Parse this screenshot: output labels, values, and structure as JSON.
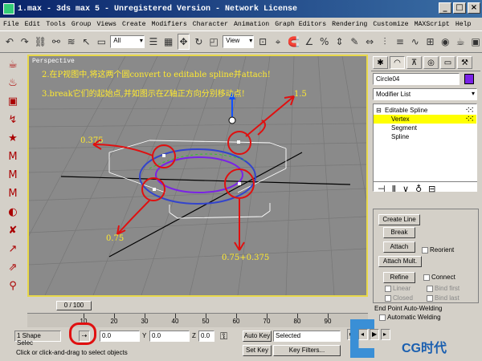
{
  "window": {
    "title": "1.max - 3ds max 5 - Unregistered Version - Network License"
  },
  "menu": [
    "File",
    "Edit",
    "Tools",
    "Group",
    "Views",
    "Create",
    "Modifiers",
    "Character",
    "Animation",
    "Graph Editors",
    "Rendering",
    "Customize",
    "MAXScript",
    "Help"
  ],
  "toolbar": {
    "selection_filter": "All",
    "ref_coord": "View"
  },
  "viewport": {
    "label": "Perspective",
    "note_line1": "2.在P视图中,将这两个圆convert to editable spline并attach!",
    "note_line2": "3.break它们的起始点,并如图示在Z轴正方向分别移动点!",
    "labels": {
      "a": "1.5",
      "b": "0.375",
      "c": "0.75",
      "d": "0.75+0.375"
    }
  },
  "command_panel": {
    "object_name": "Circle04",
    "object_color": "#7a22e6",
    "modifier_list": "Modifier List",
    "stack": {
      "root": "Editable Spline",
      "items": [
        "Vertex",
        "Segment",
        "Spline"
      ],
      "selected": "Vertex"
    },
    "geometry": {
      "create_line": "Create Line",
      "break": "Break",
      "attach": "Attach",
      "reorient": "Reorient",
      "attach_mult": "Attach Mult.",
      "refine": "Refine",
      "connect": "Connect",
      "linear": "Linear",
      "bind_first": "Bind first",
      "closed": "Closed",
      "bind_last": "Bind last",
      "endpoint_group": "End Point Auto-Welding",
      "auto_welding": "Automatic Welding"
    }
  },
  "timeline": {
    "slider_label": "0 / 100",
    "ticks": [
      "10",
      "20",
      "30",
      "40",
      "50",
      "60",
      "70",
      "80",
      "90"
    ]
  },
  "status": {
    "selection": "1 Shape Selec",
    "x": "0.0",
    "y": "0.0",
    "z": "0.0",
    "prompt": "Click or click-and-drag to select objects",
    "auto_key": "Auto Key",
    "set_key": "Set Key",
    "key_mode": "Selected",
    "key_filters": "Key Filters...",
    "watermark": "CG时代"
  }
}
